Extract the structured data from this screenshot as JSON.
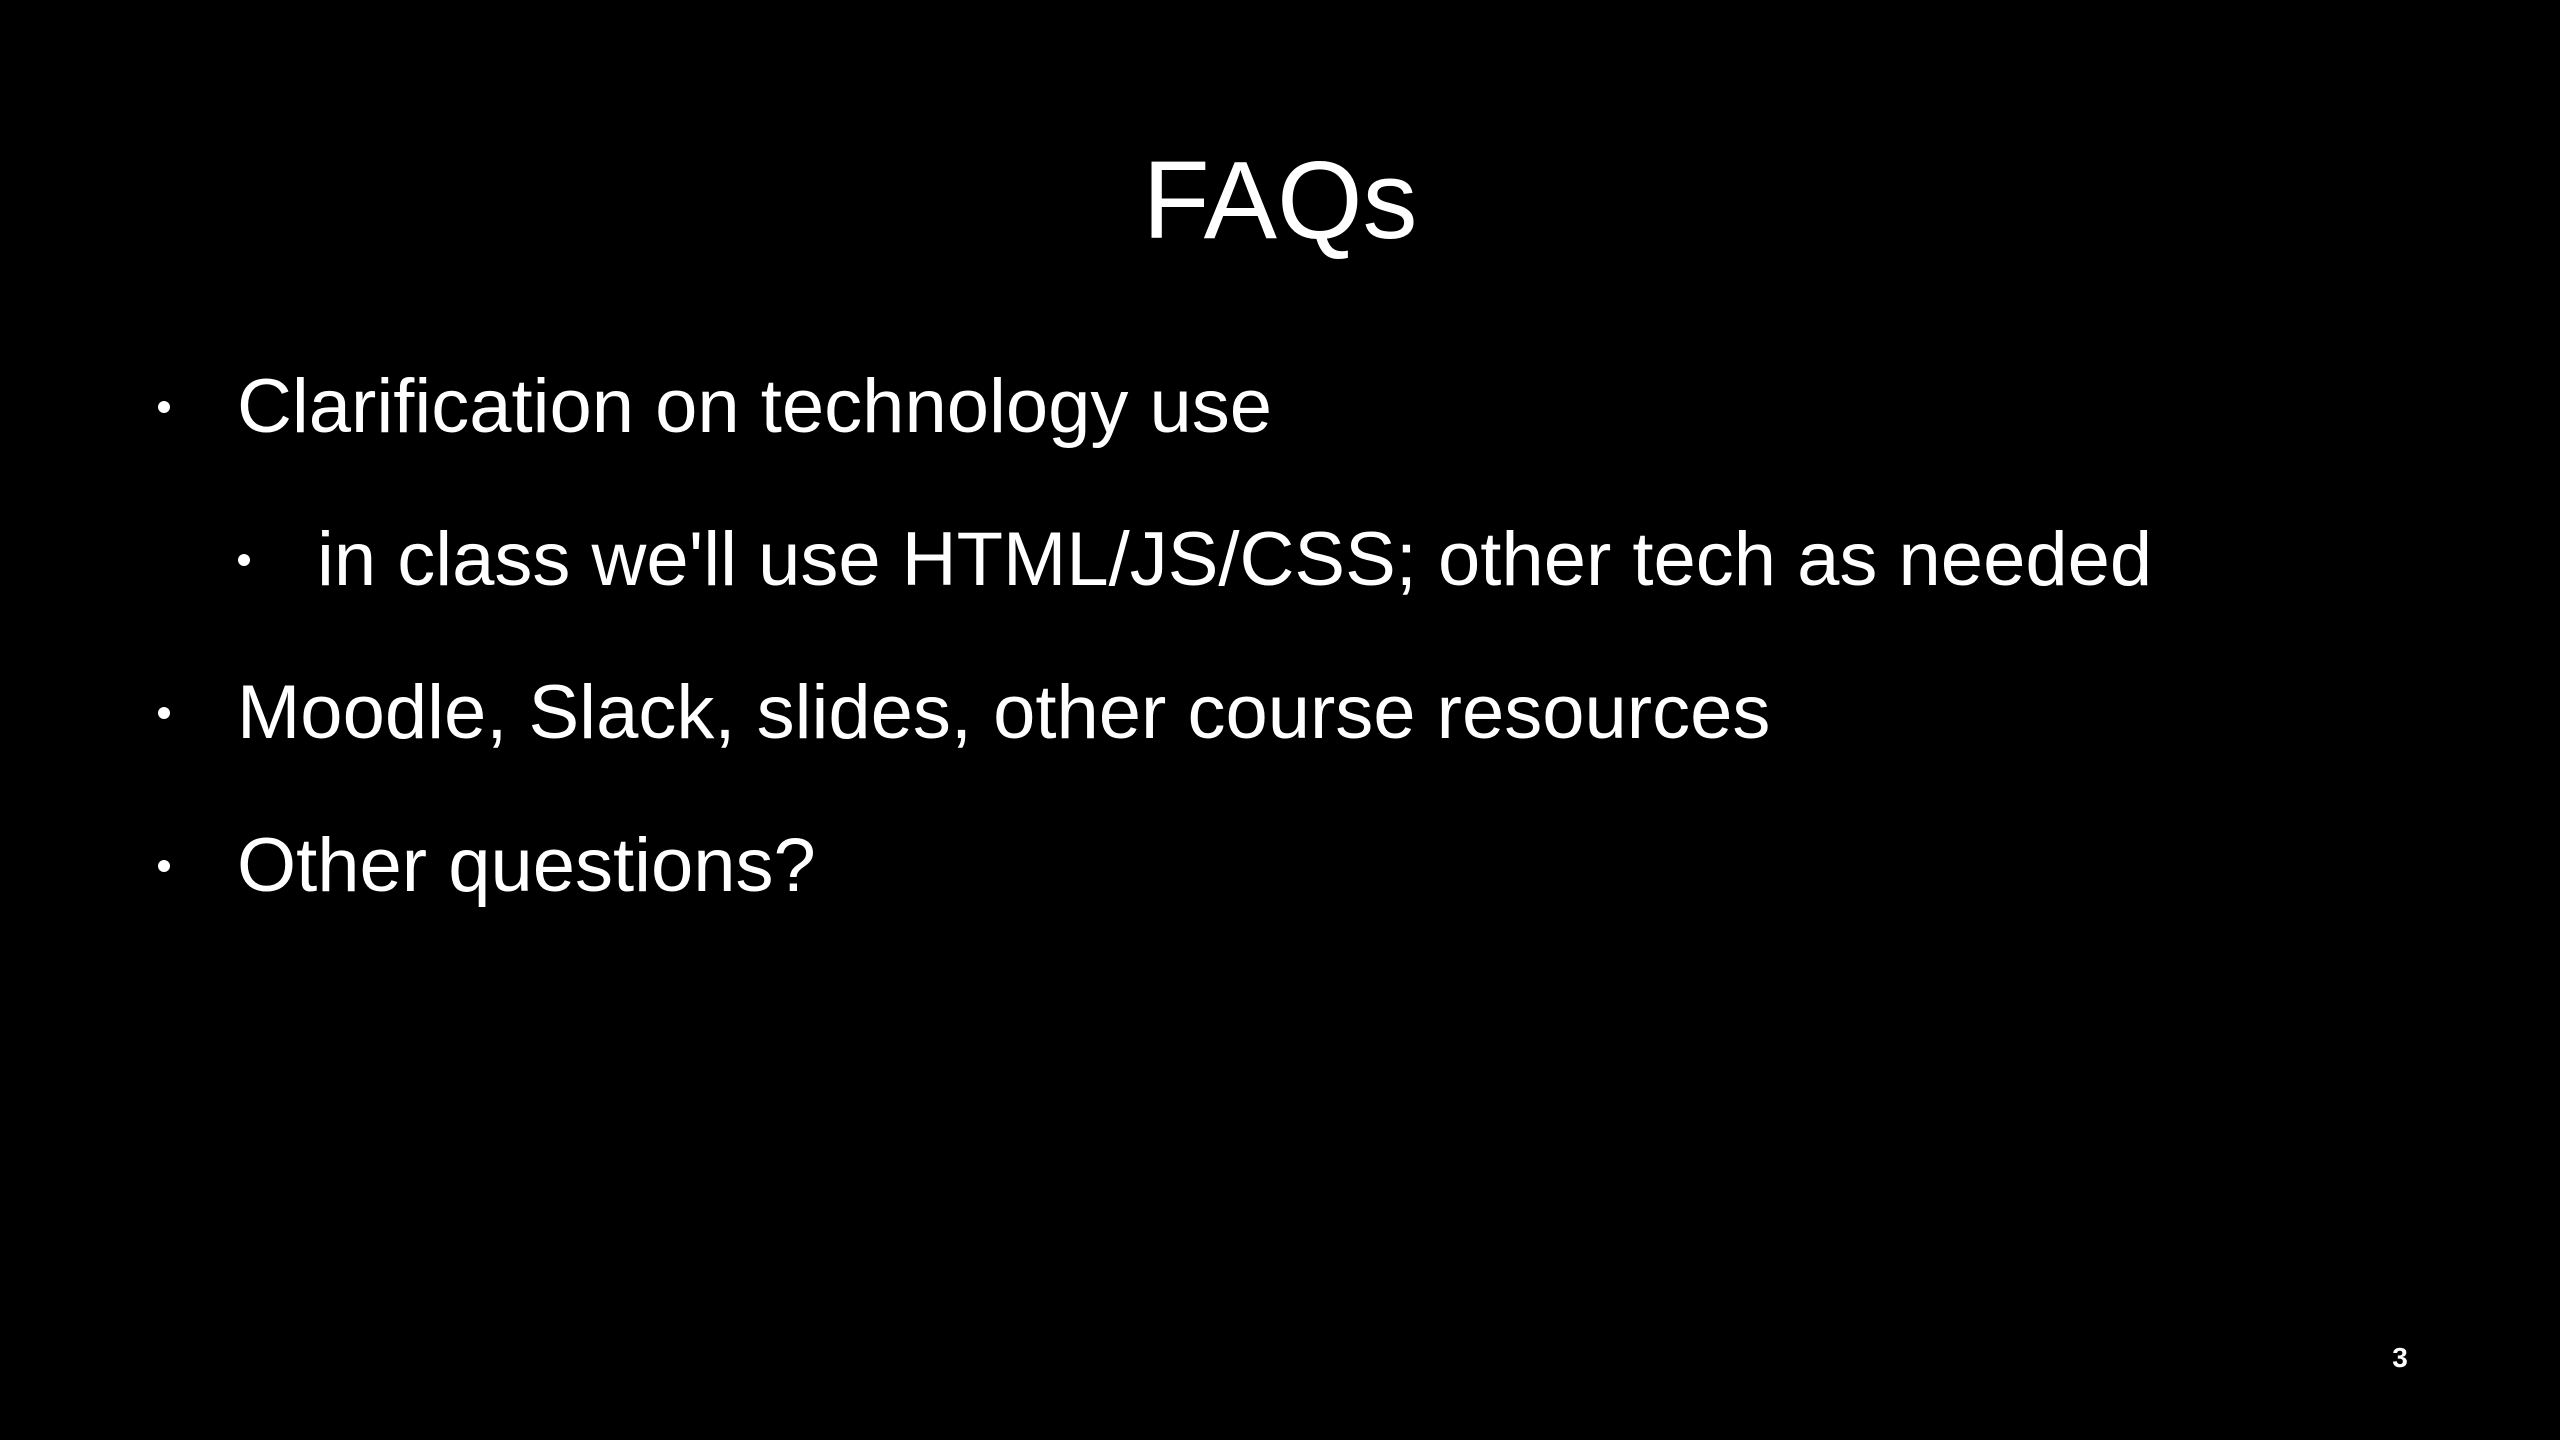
{
  "slide": {
    "title": "FAQs",
    "bullets": [
      {
        "text": "Clarification on technology use"
      },
      {
        "text": "in class we'll use HTML/JS/CSS; other tech as needed"
      },
      {
        "text": "Moodle, Slack, slides, other course resources"
      },
      {
        "text": "Other questions?"
      }
    ],
    "page_number": "3"
  },
  "colors": {
    "background": "#000000",
    "text": "#ffffff"
  }
}
